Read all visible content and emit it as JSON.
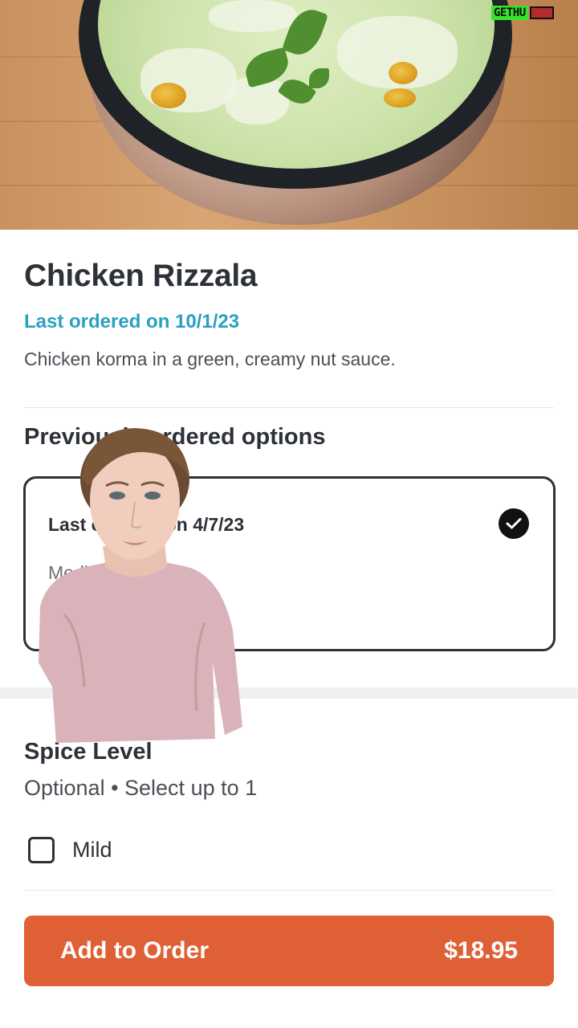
{
  "watermark": {
    "text": "GETHU"
  },
  "item": {
    "title": "Chicken Rizzala",
    "last_ordered": "Last ordered on 10/1/23",
    "description": "Chicken korma in a green, creamy nut sauce."
  },
  "previous": {
    "section_title": "Previously ordered options",
    "option": {
      "label": "Last ordered on 4/7/23",
      "sub": "Medium",
      "selected": true
    }
  },
  "spice": {
    "title": "Spice Level",
    "subtitle": "Optional • Select up to 1",
    "options": [
      {
        "label": "Mild",
        "checked": false
      }
    ]
  },
  "cta": {
    "label": "Add to Order",
    "price": "$18.95"
  },
  "colors": {
    "accent": "#e06035",
    "link": "#2aa0c0",
    "text": "#2d3138"
  },
  "icons": {
    "selected": "check-circle-icon"
  }
}
